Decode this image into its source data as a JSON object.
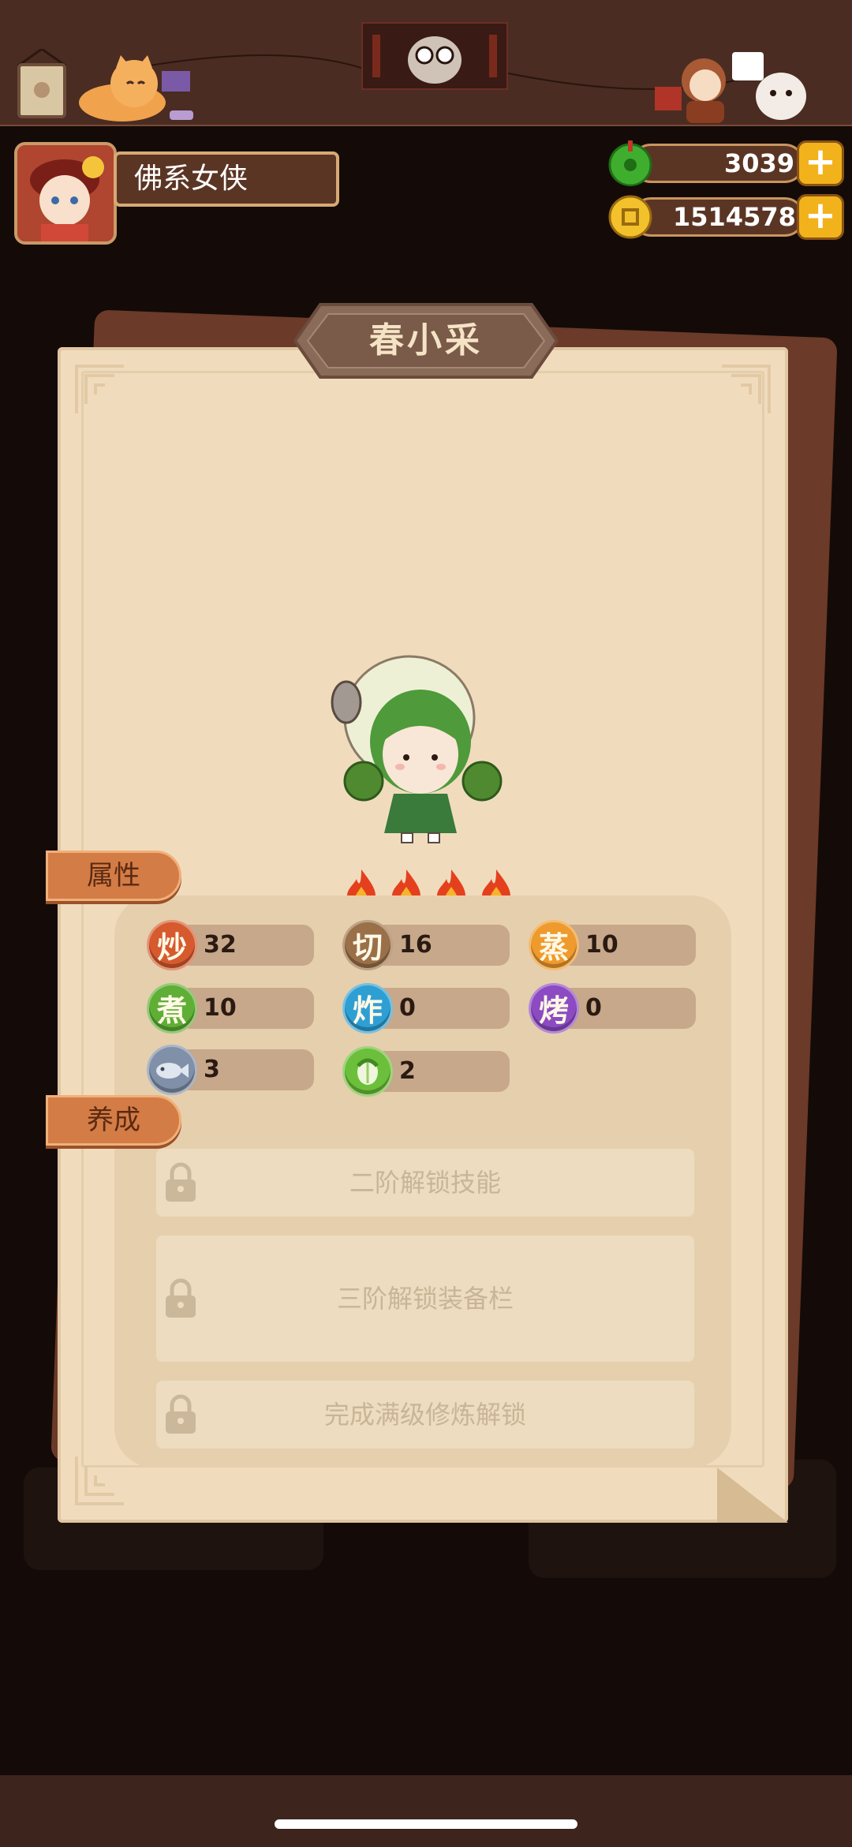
{
  "player": {
    "name": "佛系女侠"
  },
  "currencies": {
    "jade": {
      "value": "3039",
      "icon": "green-jade-icon"
    },
    "coins": {
      "value": "1514578",
      "icon": "gold-coin-icon"
    },
    "add_symbol": "+"
  },
  "character": {
    "name": "春小采",
    "stars": 4
  },
  "attributes": {
    "tab_label": "属性",
    "items": [
      {
        "glyph": "炒",
        "value": "32",
        "color": "#d65a2e"
      },
      {
        "glyph": "切",
        "value": "16",
        "color": "#9a7048"
      },
      {
        "glyph": "蒸",
        "value": "10",
        "color": "#ef9a2c"
      },
      {
        "glyph": "煮",
        "value": "10",
        "color": "#5fae35"
      },
      {
        "glyph": "炸",
        "value": "0",
        "color": "#2e9fd3"
      },
      {
        "glyph": "烤",
        "value": "0",
        "color": "#8c4bc2"
      },
      {
        "glyph": "",
        "value": "3",
        "color": "#7f90a8",
        "icon": "fish-icon"
      },
      {
        "glyph": "",
        "value": "2",
        "color": "#6cbf3a",
        "icon": "cabbage-icon"
      }
    ]
  },
  "training": {
    "tab_label": "养成",
    "locked": [
      {
        "label": "二阶解锁技能"
      },
      {
        "label": "三阶解锁装备栏"
      },
      {
        "label": "完成满级修炼解锁"
      }
    ]
  },
  "colors": {
    "top_bar": "#4a2c22",
    "card": "#f0dcbd",
    "tab": "#d47c46",
    "plus_button": "#f2b21c"
  }
}
